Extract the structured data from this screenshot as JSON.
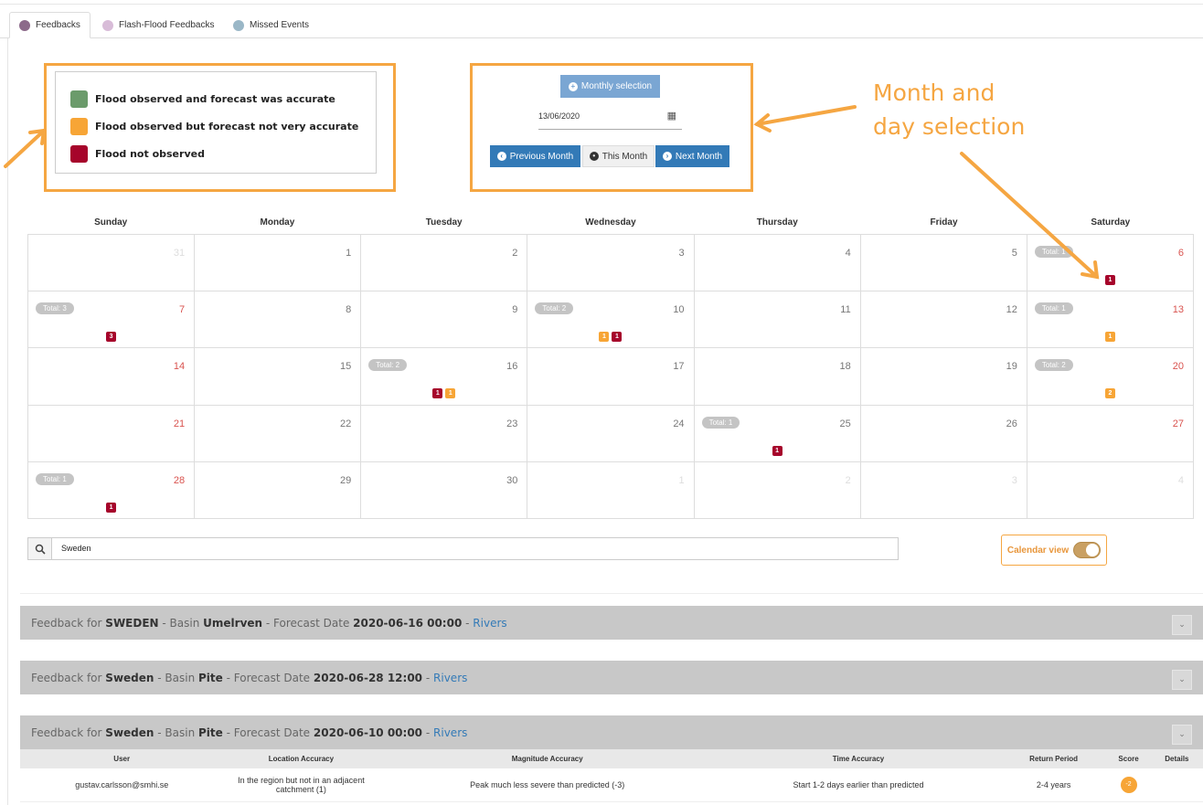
{
  "tabs": [
    {
      "label": "Feedbacks",
      "color": "#8c6a8a"
    },
    {
      "label": "Flash-Flood Feedbacks",
      "color": "#d8bcd8"
    },
    {
      "label": "Missed Events",
      "color": "#9ab7c7"
    }
  ],
  "legend": [
    {
      "label": "Flood observed and forecast was accurate",
      "color": "#6b9b6b"
    },
    {
      "label": "Flood observed but forecast not very accurate",
      "color": "#f7a536"
    },
    {
      "label": "Flood not observed",
      "color": "#a6042b"
    }
  ],
  "controls": {
    "monthly_label": "Monthly selection",
    "date_value": "13/06/2020",
    "prev_label": "Previous Month",
    "this_label": "This Month",
    "next_label": "Next Month"
  },
  "annotation": {
    "line1": "Month and",
    "line2": "day selection"
  },
  "calendar": {
    "daynames": [
      "Sunday",
      "Monday",
      "Tuesday",
      "Wednesday",
      "Thursday",
      "Friday",
      "Saturday"
    ],
    "weeks": [
      [
        {
          "day": "31",
          "other": true
        },
        {
          "day": "1"
        },
        {
          "day": "2"
        },
        {
          "day": "3"
        },
        {
          "day": "4"
        },
        {
          "day": "5"
        },
        {
          "day": "6",
          "total": "Total: 1",
          "counts": [
            {
              "v": "1",
              "c": "red"
            }
          ]
        }
      ],
      [
        {
          "day": "7",
          "total": "Total: 3",
          "counts": [
            {
              "v": "3",
              "c": "red"
            }
          ]
        },
        {
          "day": "8"
        },
        {
          "day": "9"
        },
        {
          "day": "10",
          "total": "Total: 2",
          "counts": [
            {
              "v": "1",
              "c": "orange"
            },
            {
              "v": "1",
              "c": "red"
            }
          ]
        },
        {
          "day": "11"
        },
        {
          "day": "12"
        },
        {
          "day": "13",
          "total": "Total: 1",
          "counts": [
            {
              "v": "1",
              "c": "orange"
            }
          ]
        }
      ],
      [
        {
          "day": "14"
        },
        {
          "day": "15"
        },
        {
          "day": "16",
          "total": "Total: 2",
          "counts": [
            {
              "v": "1",
              "c": "red"
            },
            {
              "v": "1",
              "c": "orange"
            }
          ]
        },
        {
          "day": "17"
        },
        {
          "day": "18"
        },
        {
          "day": "19"
        },
        {
          "day": "20",
          "total": "Total: 2",
          "counts": [
            {
              "v": "2",
              "c": "orange"
            }
          ]
        }
      ],
      [
        {
          "day": "21"
        },
        {
          "day": "22"
        },
        {
          "day": "23"
        },
        {
          "day": "24"
        },
        {
          "day": "25",
          "total": "Total: 1",
          "counts": [
            {
              "v": "1",
              "c": "red"
            }
          ]
        },
        {
          "day": "26"
        },
        {
          "day": "27"
        }
      ],
      [
        {
          "day": "28",
          "total": "Total: 1",
          "counts": [
            {
              "v": "1",
              "c": "red"
            }
          ]
        },
        {
          "day": "29"
        },
        {
          "day": "30"
        },
        {
          "day": "1",
          "other": true
        },
        {
          "day": "2",
          "other": true
        },
        {
          "day": "3",
          "other": true
        },
        {
          "day": "4",
          "other": true
        }
      ]
    ]
  },
  "search": {
    "value": "Sweden",
    "icon": "search-icon"
  },
  "calendar_view": {
    "label": "Calendar view",
    "on": true
  },
  "feedbacks": [
    {
      "prefix": "Feedback for ",
      "country": "SWEDEN",
      "basin_label": " - Basin ",
      "basin": "Umelrven",
      "date_label": " - Forecast Date ",
      "date": "2020-06-16 00:00",
      "sep": " - ",
      "link": "Rivers"
    },
    {
      "prefix": "Feedback for ",
      "country": "Sweden",
      "basin_label": " - Basin ",
      "basin": "Pite",
      "date_label": " - Forecast Date ",
      "date": "2020-06-28 12:00",
      "sep": " - ",
      "link": "Rivers"
    },
    {
      "prefix": "Feedback for ",
      "country": "Sweden",
      "basin_label": " - Basin ",
      "basin": "Pite",
      "date_label": " - Forecast Date ",
      "date": "2020-06-10 00:00",
      "sep": " - ",
      "link": "Rivers"
    }
  ],
  "table": {
    "headers": [
      "User",
      "Location Accuracy",
      "Magnitude Accuracy",
      "Time Accuracy",
      "Return Period",
      "Score",
      "Details"
    ],
    "rows": [
      [
        "gustav.carlsson@smhi.se",
        "In the region but not in an adjacent catchment (1)",
        "Peak much less severe than predicted (-3)",
        "Start 1-2 days earlier than predicted",
        "2-4 years",
        "-2",
        ""
      ]
    ]
  }
}
